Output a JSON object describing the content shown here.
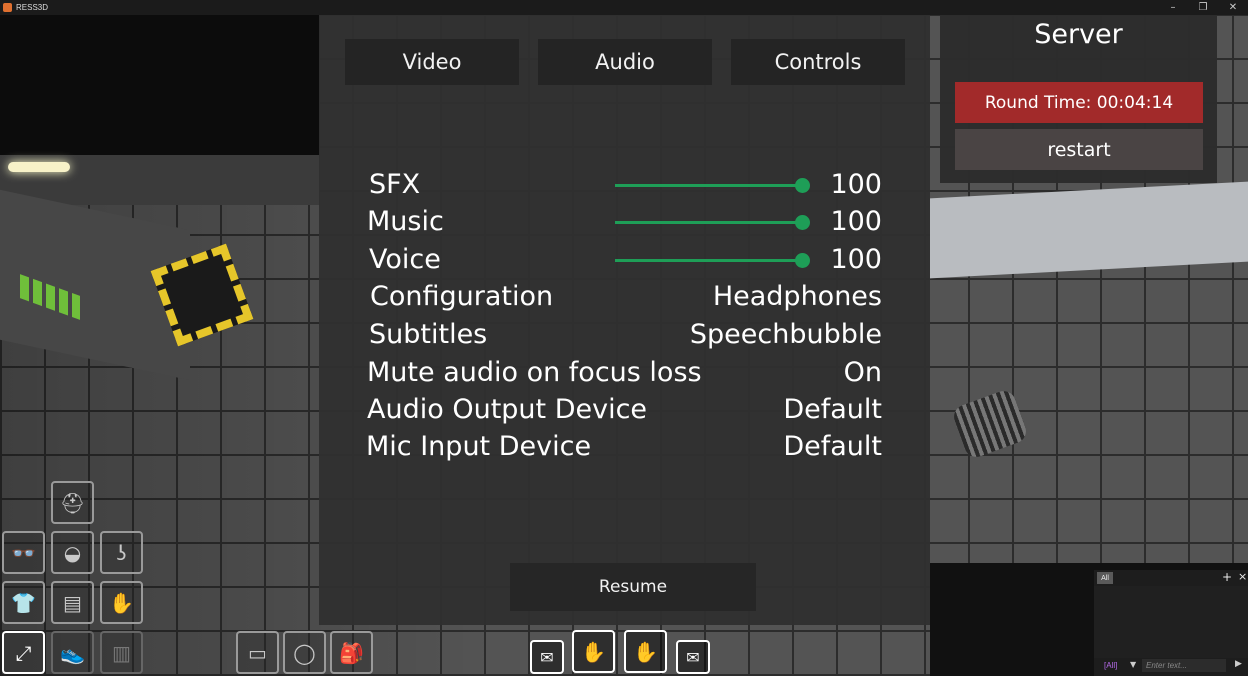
{
  "window": {
    "title": "RESS3D",
    "controls": [
      "–",
      "❐",
      "✕"
    ]
  },
  "settings": {
    "tabs": [
      "Video",
      "Audio",
      "Controls"
    ],
    "rows": [
      {
        "label": "SFX",
        "value": "100",
        "slider": 1.0
      },
      {
        "label": "Music",
        "value": "100",
        "slider": 1.0
      },
      {
        "label": "Voice",
        "value": "100",
        "slider": 1.0
      },
      {
        "label": "Configuration",
        "value": "Headphones"
      },
      {
        "label": "Subtitles",
        "value": "Speechbubble"
      },
      {
        "label": "Mute audio on focus loss",
        "value": "On"
      },
      {
        "label": "Audio Output Device",
        "value": "Default"
      },
      {
        "label": "Mic Input Device",
        "value": "Default"
      }
    ],
    "resume_label": "Resume",
    "accent_color": "#1e9e57"
  },
  "server": {
    "title": "Server",
    "round_time": "Round Time: 00:04:14",
    "restart_label": "restart",
    "round_color": "#a22a2a"
  },
  "chat": {
    "tab": "All",
    "channel": "[All]",
    "placeholder": "Enter text..."
  }
}
